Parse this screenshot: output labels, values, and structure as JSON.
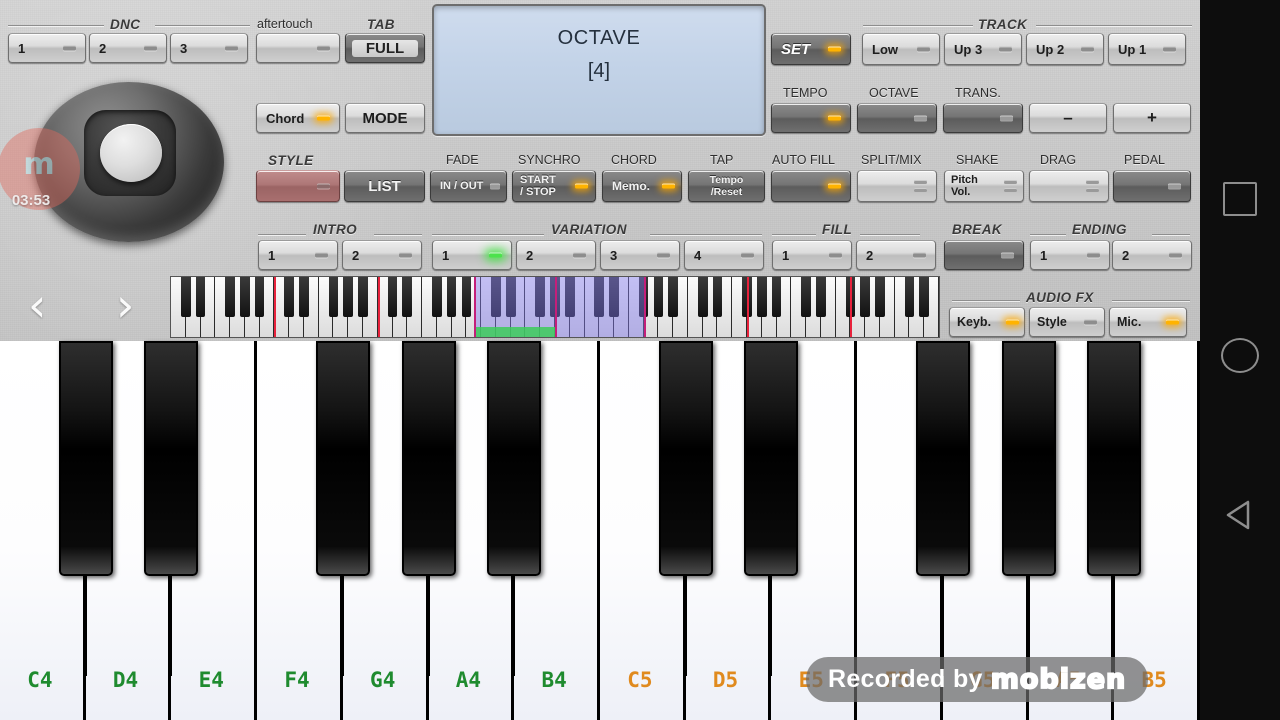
{
  "app": {
    "name": "ORG Keyboard Arranger"
  },
  "display": {
    "line1": "OCTAVE",
    "line2": "[4]"
  },
  "groups": {
    "dnc": "DNC",
    "aftertouch": "aftertouch",
    "tab": "TAB",
    "track": "TRACK",
    "style": "STYLE",
    "fade": "FADE",
    "synchro": "SYNCHRO",
    "chord": "CHORD",
    "tap": "TAP",
    "auto_fill": "AUTO FILL",
    "split_mix": "SPLIT/MIX",
    "shake": "SHAKE",
    "drag": "DRAG",
    "pedal": "PEDAL",
    "tempo": "TEMPO",
    "octave": "OCTAVE",
    "trans": "TRANS.",
    "intro": "INTRO",
    "variation": "VARIATION",
    "fill": "FILL",
    "break": "BREAK",
    "ending": "ENDING",
    "audio_fx": "AUDIO FX"
  },
  "buttons": {
    "dnc1": "1",
    "dnc2": "2",
    "dnc3": "3",
    "aftertouch": "",
    "tab_full": "FULL",
    "chord_btn": "Chord",
    "mode": "MODE",
    "set": "SET",
    "track_low": "Low",
    "track_up3": "Up 3",
    "track_up2": "Up 2",
    "track_up1": "Up 1",
    "tempo": "",
    "octave": "",
    "trans": "",
    "minus": "–",
    "plus": "+",
    "style": "",
    "list": "LIST",
    "fade_inout": "IN / OUT",
    "synchro_l1": "START",
    "synchro_l2": "/ STOP",
    "chord_memo": "Memo.",
    "tap_l1": "Tempo",
    "tap_l2": "/Reset",
    "auto_fill": "",
    "split_mix": "",
    "shake_l1": "Pitch",
    "shake_l2": "Vol.",
    "drag": "",
    "pedal": "",
    "intro1": "1",
    "intro2": "2",
    "var1": "1",
    "var2": "2",
    "var3": "3",
    "var4": "4",
    "fill1": "1",
    "fill2": "2",
    "break": "",
    "ending1": "1",
    "ending2": "2",
    "fx_keyb": "Keyb.",
    "fx_style": "Style",
    "fx_mic": "Mic."
  },
  "nav": {
    "prev": "‹",
    "next": "›"
  },
  "piano": {
    "white_keys": [
      {
        "label": "C4",
        "color": "green"
      },
      {
        "label": "D4",
        "color": "green"
      },
      {
        "label": "E4",
        "color": "green"
      },
      {
        "label": "F4",
        "color": "green"
      },
      {
        "label": "G4",
        "color": "green"
      },
      {
        "label": "A4",
        "color": "green"
      },
      {
        "label": "B4",
        "color": "green"
      },
      {
        "label": "C5",
        "color": "orange"
      },
      {
        "label": "D5",
        "color": "orange"
      },
      {
        "label": "E5",
        "color": "orange"
      },
      {
        "label": "F5",
        "color": "orange"
      },
      {
        "label": "G5",
        "color": "orange"
      },
      {
        "label": "A5",
        "color": "orange"
      },
      {
        "label": "B5",
        "color": "orange"
      }
    ]
  },
  "watermark": {
    "timer": "03:53",
    "recorded_by": "Recorded by",
    "brand": "mobizen",
    "logo_letter": "m"
  },
  "android_nav": {
    "recent": "recent-apps",
    "home": "home",
    "back": "back"
  },
  "colors": {
    "panel": "#cbcbcb",
    "lcd": "#c3d3e8",
    "led_amber": "#ffb300",
    "led_green": "#4ce24c",
    "style_red": "#ae7777",
    "key_green": "#1f8b2f",
    "key_orange": "#e08a1e",
    "select_violet": "#8078eb",
    "marker_red": "#e8223c"
  }
}
